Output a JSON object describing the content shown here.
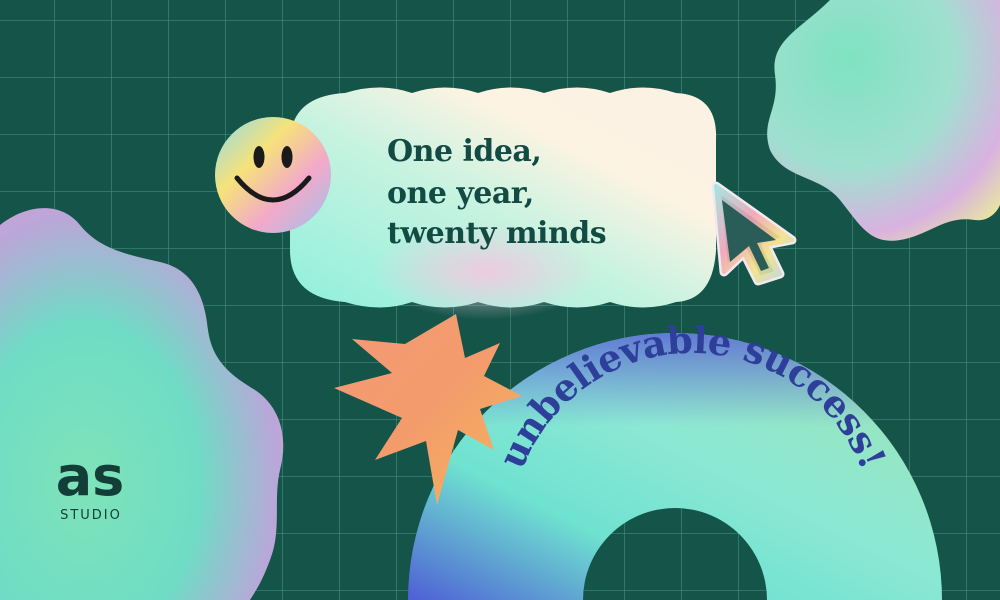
{
  "headline": {
    "lines": [
      "One idea,",
      "one year,",
      "twenty minds"
    ]
  },
  "arc_text": "unbelievable success!",
  "logo": {
    "mark": "as",
    "subtitle": "STUDIO"
  },
  "colors": {
    "background": "#145449",
    "grid": "#3e8b80",
    "headline": "#124b44",
    "arc_text": "#2e3f9a",
    "logo": "#123e37"
  },
  "icons": [
    "smiley-face-icon",
    "cursor-arrow-icon",
    "star-burst-icon"
  ]
}
